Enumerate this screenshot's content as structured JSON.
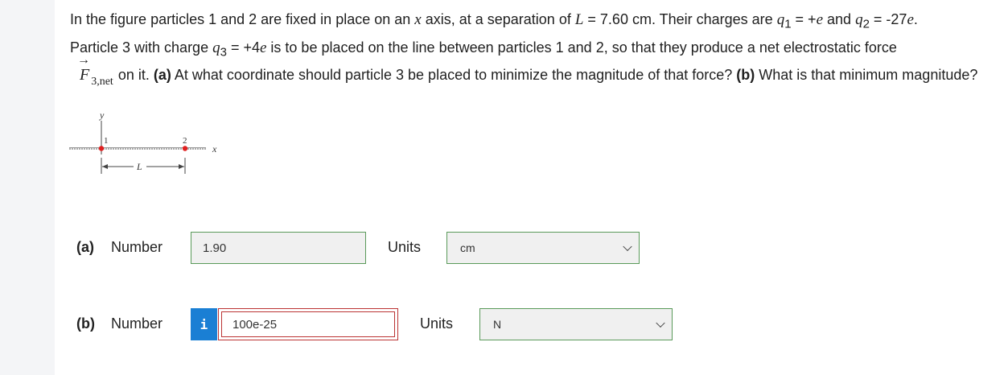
{
  "question": {
    "line1_a": "In the figure particles 1 and 2 are fixed in place on an ",
    "x_var": "x",
    "line1_b": " axis, at a separation of ",
    "L_var": "L",
    "line1_c": " = 7.60 cm. Their charges are ",
    "q1": "q",
    "q1_sub": "1",
    "q1_val": " = +",
    "e1": "e",
    "and": " and ",
    "q2": "q",
    "q2_sub": "2",
    "q2_val": " = -27",
    "e2": "e",
    "period1": ".",
    "line2_a": "Particle 3 with charge ",
    "q3": "q",
    "q3_sub": "3",
    "q3_val": " = +4",
    "e3": "e",
    "line2_b": " is to be placed on the line between particles 1 and 2, so that they produce a net electrostatic force",
    "F": "F",
    "F_sub": "3,net",
    "line3_a": "on it. ",
    "part_a_tag": "(a)",
    "line3_b": " At what coordinate should particle 3 be placed to minimize the magnitude of that force? ",
    "part_b_tag": "(b)",
    "line3_c": " What is that minimum magnitude?"
  },
  "figure": {
    "y_axis": "y",
    "x_axis": "x",
    "p1": "1",
    "p2": "2",
    "L": "L"
  },
  "part_a": {
    "label": "(a)",
    "number_label": "Number",
    "value": "1.90",
    "units_label": "Units",
    "unit": "cm"
  },
  "part_b": {
    "label": "(b)",
    "number_label": "Number",
    "info": "i",
    "value": "100e-25",
    "units_label": "Units",
    "unit": "N"
  }
}
